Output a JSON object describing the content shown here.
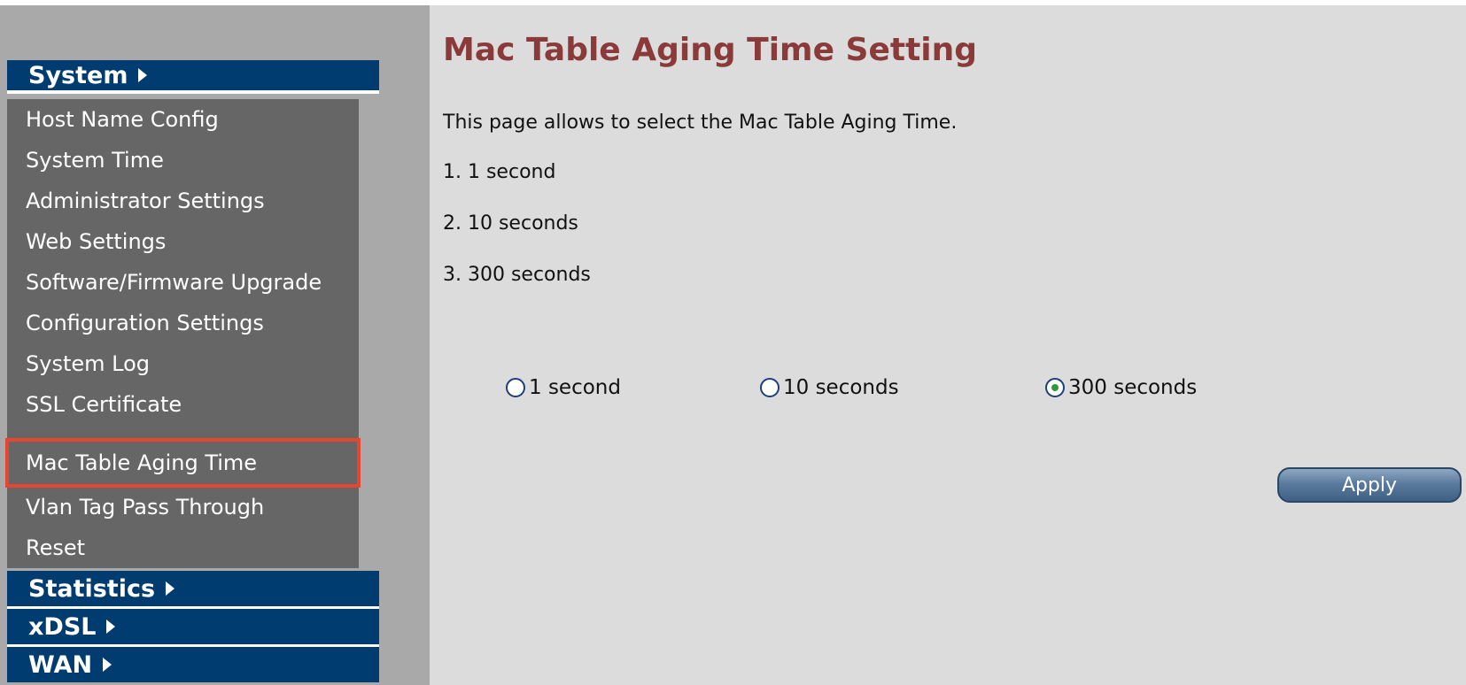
{
  "sidebar": {
    "sections": [
      {
        "label": "System"
      },
      {
        "label": "Statistics"
      },
      {
        "label": "xDSL"
      },
      {
        "label": "WAN"
      }
    ],
    "items": [
      {
        "label": "Host Name Config"
      },
      {
        "label": "System Time"
      },
      {
        "label": "Administrator Settings"
      },
      {
        "label": "Web Settings"
      },
      {
        "label": "Software/Firmware Upgrade"
      },
      {
        "label": "Configuration Settings"
      },
      {
        "label": "System Log"
      },
      {
        "label": "SSL Certificate"
      },
      {
        "label": "Mac Table Aging Time"
      },
      {
        "label": "Vlan Tag Pass Through"
      },
      {
        "label": "Reset"
      }
    ],
    "highlighted_item": "Mac Table Aging Time",
    "colors": {
      "section_header_bg": "#003c70",
      "menu_panel_bg": "#666666",
      "highlight_border": "#e8452f"
    }
  },
  "main": {
    "title": "Mac Table Aging Time Setting",
    "description": "This page allows to select the Mac Table Aging Time.",
    "options_list": [
      "1. 1 second",
      "2. 10 seconds",
      "3. 300 seconds"
    ],
    "radio_options": [
      {
        "label": "1 second",
        "checked": false
      },
      {
        "label": "10 seconds",
        "checked": false
      },
      {
        "label": "300 seconds",
        "checked": true
      }
    ],
    "apply_label": "Apply",
    "colors": {
      "title": "#8b3a3a",
      "background": "#dcdcdc"
    }
  }
}
